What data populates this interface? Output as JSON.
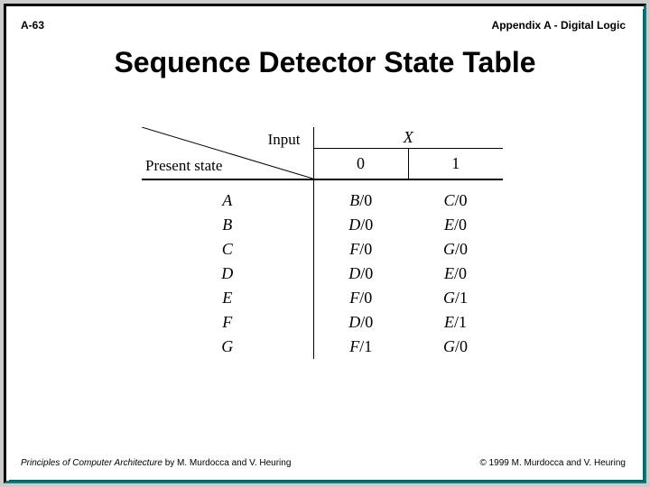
{
  "header": {
    "left": "A-63",
    "right": "Appendix A - Digital Logic"
  },
  "title": "Sequence Detector State Table",
  "table": {
    "diag_top": "Input",
    "diag_bottom": "Present state",
    "input_var": "X",
    "cols": [
      "0",
      "1"
    ],
    "rows": [
      {
        "state": "A",
        "c0s": "B",
        "c0o": "/0",
        "c1s": "C",
        "c1o": "/0"
      },
      {
        "state": "B",
        "c0s": "D",
        "c0o": "/0",
        "c1s": "E",
        "c1o": "/0"
      },
      {
        "state": "C",
        "c0s": "F",
        "c0o": "/0",
        "c1s": "G",
        "c1o": "/0"
      },
      {
        "state": "D",
        "c0s": "D",
        "c0o": "/0",
        "c1s": "E",
        "c1o": "/0"
      },
      {
        "state": "E",
        "c0s": "F",
        "c0o": "/0",
        "c1s": "G",
        "c1o": "/1"
      },
      {
        "state": "F",
        "c0s": "D",
        "c0o": "/0",
        "c1s": "E",
        "c1o": "/1"
      },
      {
        "state": "G",
        "c0s": "F",
        "c0o": "/1",
        "c1s": "G",
        "c1o": "/0"
      }
    ]
  },
  "footer": {
    "book": "Principles of Computer Architecture",
    "authors": " by M. Murdocca and V. Heuring",
    "copyright": "© 1999 M. Murdocca and V. Heuring"
  }
}
